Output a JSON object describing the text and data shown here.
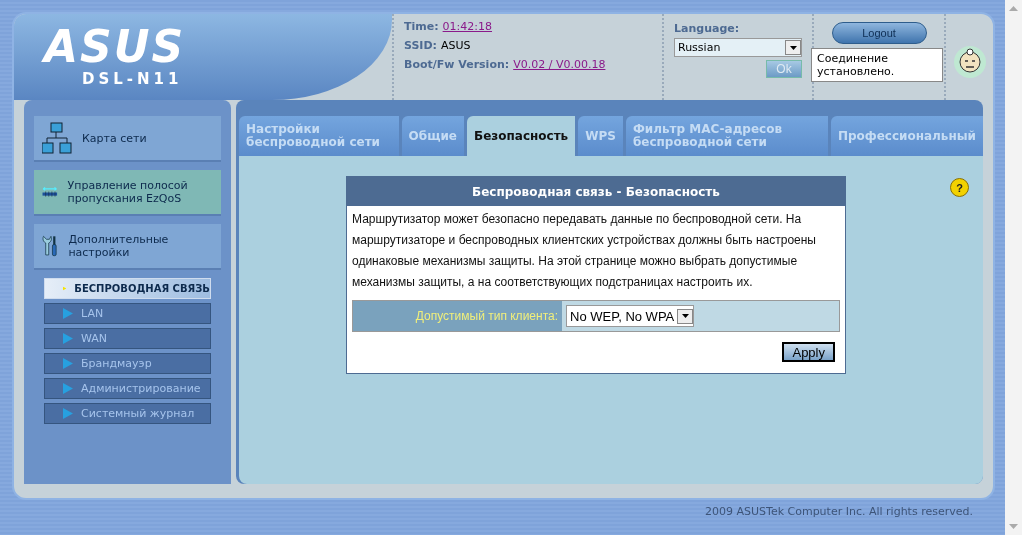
{
  "header": {
    "brand": "ASUS",
    "model": "DSL-N11",
    "time_label": "Time:",
    "time": "01:42:18",
    "ssid_label": "SSID:",
    "ssid": "ASUS",
    "version_label": "Boot/Fw Version:",
    "version": "V0.02 / V0.00.18",
    "language_label": "Language:",
    "language": "Russian",
    "ok": "Ok",
    "logout": "Logout",
    "status_bubble": "Соединение установлено."
  },
  "sidebar": {
    "items": [
      {
        "kind": "map",
        "label": "Карта сети"
      },
      {
        "kind": "qos",
        "label": "Управление полосой пропускания EzQoS"
      },
      {
        "kind": "advanced",
        "label": "Дополнительные настройки"
      }
    ],
    "submenu": [
      {
        "label": "БЕСПРОВОДНАЯ СВЯЗЬ",
        "selected": true
      },
      {
        "label": "LAN",
        "selected": false
      },
      {
        "label": "WAN",
        "selected": false
      },
      {
        "label": "Брандмауэр",
        "selected": false
      },
      {
        "label": "Администрирование",
        "selected": false
      },
      {
        "label": "Системный журнал",
        "selected": false
      }
    ]
  },
  "tabs": [
    {
      "label": "Настройки беспроводной сети",
      "selected": false
    },
    {
      "label": "Общие",
      "selected": false
    },
    {
      "label": "Безопасность",
      "selected": true
    },
    {
      "label": "WPS",
      "selected": false
    },
    {
      "label": "Фильтр MAC-адресов беспроводной сети",
      "selected": false
    },
    {
      "label": "Профессиональный",
      "selected": false
    }
  ],
  "help": "?",
  "panel": {
    "title": "Беспроводная связь - Безопасность",
    "description": "Маршрутизатор может безопасно передавать данные по беспроводной сети. На маршрутизаторе и беспроводных клиентских устройствах должны быть настроены одинаковые механизмы защиты. На этой странице можно выбрать допустимые механизмы защиты, а на соответствующих подстраницах настроить их.",
    "field_label": "Допустимый тип клиента:",
    "field_value": "No WEP, No WPA",
    "apply": "Apply"
  },
  "footer": "2009 ASUSTek Computer Inc. All rights reserved."
}
